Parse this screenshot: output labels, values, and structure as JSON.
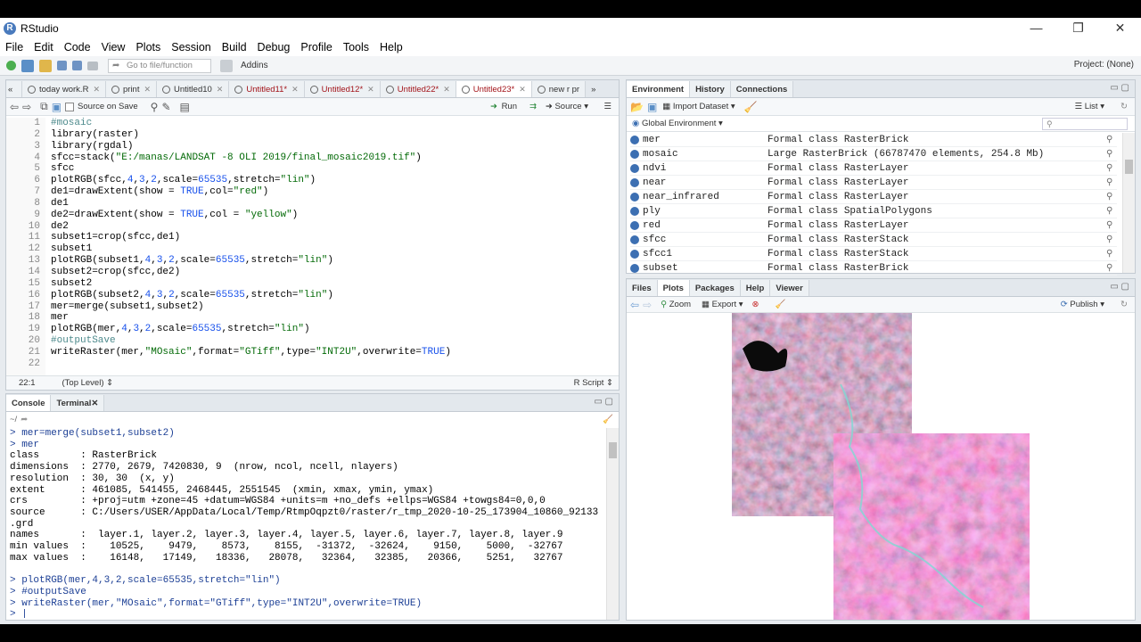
{
  "window": {
    "title": "RStudio",
    "logo": "R",
    "min": "—",
    "restore": "❐",
    "close": "✕"
  },
  "menu": [
    "File",
    "Edit",
    "Code",
    "View",
    "Plots",
    "Session",
    "Build",
    "Debug",
    "Profile",
    "Tools",
    "Help"
  ],
  "toolbar": {
    "goto_placeholder": "Go to file/function",
    "addins": "Addins",
    "project": "Project: (None)"
  },
  "editor": {
    "tabs": [
      {
        "label": "today work.R",
        "modified": false
      },
      {
        "label": "print",
        "modified": false
      },
      {
        "label": "Untitled10",
        "modified": false
      },
      {
        "label": "Untitled11*",
        "modified": true
      },
      {
        "label": "Untitled12*",
        "modified": true
      },
      {
        "label": "Untitled22*",
        "modified": true
      },
      {
        "label": "Untitled23*",
        "modified": true,
        "active": true
      },
      {
        "label": "new r pr",
        "modified": false
      }
    ],
    "source_on_save": "Source on Save",
    "run": "Run",
    "source": "Source",
    "position": "22:1",
    "scope": "(Top Level)",
    "filetype": "R Script",
    "lines": [
      "#mosaic",
      "library(raster)",
      "library(rgdal)",
      "sfcc=stack(\"E:/manas/LANDSAT -8 OLI 2019/final_mosaic2019.tif\")",
      "sfcc",
      "plotRGB(sfcc,4,3,2,scale=65535,stretch=\"lin\")",
      "de1=drawExtent(show = TRUE,col=\"red\")",
      "de1",
      "de2=drawExtent(show = TRUE,col = \"yellow\")",
      "de2",
      "subset1=crop(sfcc,de1)",
      "subset1",
      "plotRGB(subset1,4,3,2,scale=65535,stretch=\"lin\")",
      "subset2=crop(sfcc,de2)",
      "subset2",
      "plotRGB(subset2,4,3,2,scale=65535,stretch=\"lin\")",
      "mer=merge(subset1,subset2)",
      "mer",
      "plotRGB(mer,4,3,2,scale=65535,stretch=\"lin\")",
      "#outputSave",
      "writeRaster(mer,\"MOsaic\",format=\"GTiff\",type=\"INT2U\",overwrite=TRUE)",
      ""
    ]
  },
  "console": {
    "tabs": [
      "Console",
      "Terminal"
    ],
    "path": "~/",
    "lines": [
      "> mer=merge(subset1,subset2)",
      "> mer",
      "class       : RasterBrick",
      "dimensions  : 2770, 2679, 7420830, 9  (nrow, ncol, ncell, nlayers)",
      "resolution  : 30, 30  (x, y)",
      "extent      : 461085, 541455, 2468445, 2551545  (xmin, xmax, ymin, ymax)",
      "crs         : +proj=utm +zone=45 +datum=WGS84 +units=m +no_defs +ellps=WGS84 +towgs84=0,0,0",
      "source      : C:/Users/USER/AppData/Local/Temp/RtmpOqpzt0/raster/r_tmp_2020-10-25_173904_10860_92133",
      ".grd",
      "names       :  layer.1, layer.2, layer.3, layer.4, layer.5, layer.6, layer.7, layer.8, layer.9",
      "min values  :    10525,    9479,    8573,    8155,  -31372,  -32624,    9150,    5000,  -32767",
      "max values  :    16148,   17149,   18336,   28078,   32364,   32385,   20366,    5251,   32767",
      "",
      "> plotRGB(mer,4,3,2,scale=65535,stretch=\"lin\")",
      "> #outputSave",
      "> writeRaster(mer,\"MOsaic\",format=\"GTiff\",type=\"INT2U\",overwrite=TRUE)",
      "> |"
    ]
  },
  "environment": {
    "tabs": [
      "Environment",
      "History",
      "Connections"
    ],
    "import_dataset": "Import Dataset",
    "list_label": "List",
    "scope": "Global Environment",
    "rows": [
      {
        "name": "mer",
        "value": "Formal class RasterBrick"
      },
      {
        "name": "mosaic",
        "value": "Large RasterBrick (66787470 elements, 254.8 Mb)"
      },
      {
        "name": "ndvi",
        "value": "Formal class RasterLayer"
      },
      {
        "name": "near",
        "value": "Formal class RasterLayer"
      },
      {
        "name": "near_infrared",
        "value": "Formal class RasterLayer"
      },
      {
        "name": "ply",
        "value": "Formal class SpatialPolygons"
      },
      {
        "name": "red",
        "value": "Formal class RasterLayer"
      },
      {
        "name": "sfcc",
        "value": "Formal class RasterStack"
      },
      {
        "name": "sfcc1",
        "value": "Formal class RasterStack"
      },
      {
        "name": "subset",
        "value": "Formal class RasterBrick"
      }
    ]
  },
  "files": {
    "tabs": [
      "Files",
      "Plots",
      "Packages",
      "Help",
      "Viewer"
    ],
    "zoom": "Zoom",
    "export": "Export",
    "publish": "Publish"
  }
}
